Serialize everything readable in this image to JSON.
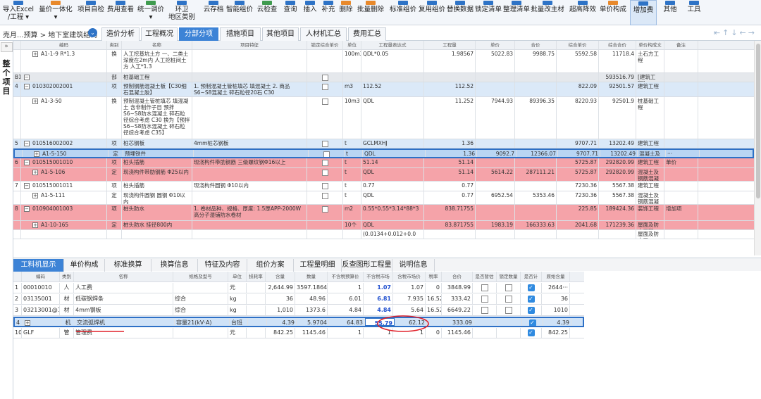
{
  "toolbar": {
    "items": [
      {
        "label": "导入Excel",
        "label2": "/工程 ▾"
      },
      {
        "label": "量价一体化",
        "label2": "▾"
      },
      {
        "label": "项目自检",
        "label2": ""
      },
      {
        "label": "费用查看",
        "label2": ""
      },
      {
        "label": "统一调价",
        "label2": "▾"
      },
      {
        "label": "环卫",
        "label2": "地区类别"
      },
      {
        "label": "云存档",
        "label2": ""
      },
      {
        "label": "智能组价",
        "label2": ""
      },
      {
        "label": "云检查",
        "label2": ""
      },
      {
        "label": "查询",
        "label2": ""
      },
      {
        "label": "插入",
        "label2": ""
      },
      {
        "label": "补充",
        "label2": ""
      },
      {
        "label": "删除",
        "label2": ""
      },
      {
        "label": "批量删除",
        "label2": ""
      },
      {
        "label": "标准组价",
        "label2": ""
      },
      {
        "label": "复用组价",
        "label2": ""
      },
      {
        "label": "替换数据",
        "label2": ""
      },
      {
        "label": "锁定清单",
        "label2": ""
      },
      {
        "label": "整理清单",
        "label2": ""
      },
      {
        "label": "批量改主材",
        "label2": ""
      },
      {
        "label": "超高降效",
        "label2": ""
      },
      {
        "label": "单价构成",
        "label2": ""
      },
      {
        "label": "增加费",
        "label2": ""
      },
      {
        "label": "其他",
        "label2": ""
      },
      {
        "label": "工具",
        "label2": ""
      }
    ]
  },
  "breadcrumb": "売月...预算 > 地下室建筑结构",
  "tabs": [
    "造价分析",
    "工程概况",
    "分部分项",
    "措施项目",
    "其他项目",
    "人材机汇总",
    "费用汇总"
  ],
  "active_tab": "分部分项",
  "rail_label": "整个项目",
  "grid": {
    "headers": [
      "编码",
      "类别",
      "名称",
      "项目特征",
      "锁定综合单价",
      "单位",
      "工程量表达式",
      "工程量",
      "单价",
      "合价",
      "综合单价",
      "综合合价",
      "单价构成文件",
      "备注"
    ],
    "rows": [
      {
        "idx": "",
        "code": "A1-1-9 R*1.3",
        "type": "换",
        "name": "人工挖基坑土方 一、二类土 深度在2m内 人工挖桩间土方 人工*1.3",
        "feature": "",
        "unit": "100m3",
        "expr": "QDL*0.05",
        "qty": "1.98567",
        "price": "5022.83",
        "total": "9988.75",
        "uprice": "5592.58",
        "utotal": "11718.4",
        "file": "土石方工程",
        "note": ""
      },
      {
        "idx": "B1",
        "code": "",
        "type": "部",
        "name": "桩基础工程",
        "feature": "",
        "unit": "",
        "expr": "",
        "qty": "",
        "price": "",
        "total": "",
        "uprice": "",
        "utotal": "593516.79",
        "file": "[建筑工程]",
        "note": ""
      },
      {
        "idx": "4",
        "code": "010302002001",
        "type": "项",
        "name": "预制钢筋混凝土板【C30细石混凝土胶】",
        "feature": "1. 预制混凝土管桩填芯 填混凝土 2. 商品S6~S8混凝土 碎石粒径20石 C30",
        "unit": "m3",
        "expr": "112.52",
        "qty": "112.52",
        "price": "",
        "total": "",
        "uprice": "822.09",
        "utotal": "92501.57",
        "file": "建筑工程",
        "note": ""
      },
      {
        "idx": "",
        "code": "A1-3-50",
        "type": "换",
        "name": "预制混凝土管桩填芯 填混凝土 含非制作子目 预拌S6~S8防水混凝土 碎石粒径综合考虑 C30 换为【预拌S6~S8防水混凝土 碎石粒径综合考虑 C35】",
        "feature": "",
        "unit": "10m3",
        "expr": "QDL",
        "qty": "11.252",
        "price": "7944.93",
        "total": "89396.35",
        "uprice": "8220.93",
        "utotal": "92501.9",
        "file": "桩基础工程",
        "note": ""
      },
      {
        "idx": "5",
        "code": "010516002002",
        "type": "项",
        "name": "桩芯钢板",
        "feature": "4mm桩芯钢板",
        "unit": "t",
        "expr": "GCLMXHJ",
        "qty": "1.36",
        "price": "",
        "total": "",
        "uprice": "9707.71",
        "utotal": "13202.49",
        "file": "建筑工程",
        "note": ""
      },
      {
        "idx": "",
        "code": "A1-5-150",
        "type": "定",
        "name": "预埋铁件",
        "feature": "",
        "unit": "t",
        "expr": "QDL",
        "qty": "1.36",
        "price": "9092.7",
        "total": "12366.07",
        "uprice": "9707.71",
        "utotal": "13202.49",
        "file": "混凝土及钢…",
        "note": "···"
      },
      {
        "idx": "6",
        "code": "010515001010",
        "type": "项",
        "name": "桩头插筋",
        "feature": "现浇构件带肋钢筋 三级螺纹钢Φ16以上",
        "unit": "t",
        "expr": "51.14",
        "qty": "51.14",
        "price": "",
        "total": "",
        "uprice": "5725.87",
        "utotal": "292820.99",
        "file": "建筑工程",
        "note": "单价"
      },
      {
        "idx": "",
        "code": "A1-5-106",
        "type": "定",
        "name": "现浇构件带肋钢筋 Φ25以内",
        "feature": "",
        "unit": "t",
        "expr": "QDL",
        "qty": "51.14",
        "price": "5614.22",
        "total": "287111.21",
        "uprice": "5725.87",
        "utotal": "292820.99",
        "file": "混凝土及钢筋混凝土工程",
        "note": ""
      },
      {
        "idx": "7",
        "code": "010515001011",
        "type": "项",
        "name": "桩头插筋",
        "feature": "现浇构件圆钢 Φ10以内",
        "unit": "t",
        "expr": "0.77",
        "qty": "0.77",
        "price": "",
        "total": "",
        "uprice": "7230.36",
        "utotal": "5567.38",
        "file": "建筑工程",
        "note": ""
      },
      {
        "idx": "",
        "code": "A1-5-111",
        "type": "定",
        "name": "现浇构件圆钢 圆钢 Φ10以内",
        "feature": "",
        "unit": "t",
        "expr": "QDL",
        "qty": "0.77",
        "price": "6952.54",
        "total": "5353.46",
        "uprice": "7230.36",
        "utotal": "5567.38",
        "file": "混凝土及钢筋混凝土工程",
        "note": ""
      },
      {
        "idx": "8",
        "code": "010904001003",
        "type": "项",
        "name": "桩头防水",
        "feature": "1. 卷材品种、规格、厚度: 1.5厚APP-2000W高分子湿铺防水卷材",
        "unit": "m2",
        "expr": "0.55*0.55*3.14*88*3",
        "qty": "838.71755",
        "price": "",
        "total": "",
        "uprice": "225.85",
        "utotal": "189424.36",
        "file": "装饰工程",
        "note": "增加项"
      },
      {
        "idx": "",
        "code": "A1-10-165",
        "type": "定",
        "name": "桩头防水 挂径800内",
        "feature": "",
        "unit": "10个",
        "expr": "QDL",
        "qty": "83.871755",
        "price": "1983.19",
        "total": "166333.63",
        "uprice": "2041.68",
        "utotal": "171239.36",
        "file": "屋面及防水工程",
        "note": ""
      },
      {
        "idx": "",
        "code": "",
        "type": "",
        "name": "",
        "feature": "",
        "unit": "",
        "expr": "(0.0134+0.012+0.0",
        "qty": "",
        "price": "",
        "total": "",
        "uprice": "",
        "utotal": "",
        "file": "屋面及防水工",
        "note": ""
      }
    ]
  },
  "lower_tabs": [
    "工料机显示",
    "单价构成",
    "标准换算",
    "换算信息",
    "特征及内容",
    "组价方案",
    "工程量明细",
    "反查图形工程量",
    "说明信息"
  ],
  "lower_active": "工料机显示",
  "lower": {
    "headers": [
      "编码",
      "类别",
      "名称",
      "规格及型号",
      "单位",
      "损耗率",
      "含量",
      "数量",
      "不含税预算价",
      "不含税市场价",
      "含税市场价",
      "税率",
      "合价",
      "是否暂估",
      "锁定数量",
      "是否计价",
      "原始含量"
    ],
    "rows": [
      {
        "idx": "1",
        "code": "00010010",
        "type": "人",
        "name": "人工费",
        "spec": "",
        "unit": "元",
        "loss": "",
        "content": "2,644.99",
        "amount": "3597.1864",
        "budget": "1",
        "market": "1.07",
        "taxprice": "1.07",
        "rate": "0",
        "total": "3848.99",
        "zg": false,
        "lock": false,
        "pricing": true,
        "orig": "2644···"
      },
      {
        "idx": "2",
        "code": "03135001",
        "type": "材",
        "name": "低碳钢焊条",
        "spec": "综合",
        "unit": "kg",
        "loss": "",
        "content": "36",
        "amount": "48.96",
        "budget": "6.01",
        "market": "6.81",
        "taxprice": "7.935",
        "rate": "16.52",
        "total": "333.42",
        "zg": false,
        "lock": false,
        "pricing": true,
        "orig": "36"
      },
      {
        "idx": "3",
        "code": "03213001@1",
        "type": "材",
        "name": "4mm钢板",
        "spec": "综合",
        "unit": "kg",
        "loss": "",
        "content": "1,010",
        "amount": "1373.6",
        "budget": "4.84",
        "market": "4.84",
        "taxprice": "5.64",
        "rate": "16.52",
        "total": "6649.22",
        "zg": false,
        "lock": false,
        "pricing": true,
        "orig": "1010"
      },
      {
        "idx": "4",
        "code": "990901010",
        "type": "机",
        "name": "交流弧焊机",
        "spec": "容量21(kV·A)",
        "unit": "台班",
        "loss": "",
        "content": "4.39",
        "amount": "5.9704",
        "budget": "64.83",
        "market": "55.79",
        "taxprice": "62.12",
        "rate": "",
        "total": "333.09",
        "zg": false,
        "lock": false,
        "pricing": true,
        "orig": "4.39"
      },
      {
        "idx": "10",
        "code": "GLF",
        "type": "管",
        "name": "管理费",
        "spec": "",
        "unit": "元",
        "loss": "",
        "content": "842.25",
        "amount": "1145.46",
        "budget": "1",
        "market": "1",
        "taxprice": "1",
        "rate": "0",
        "total": "1145.46",
        "zg": false,
        "lock": false,
        "pricing": true,
        "orig": "842.25"
      }
    ]
  },
  "colors": {
    "accent": "#3d83d6",
    "red_row": "#f5a3a9",
    "blue_row": "#dbe9f8",
    "annotation": "#e0202a"
  }
}
